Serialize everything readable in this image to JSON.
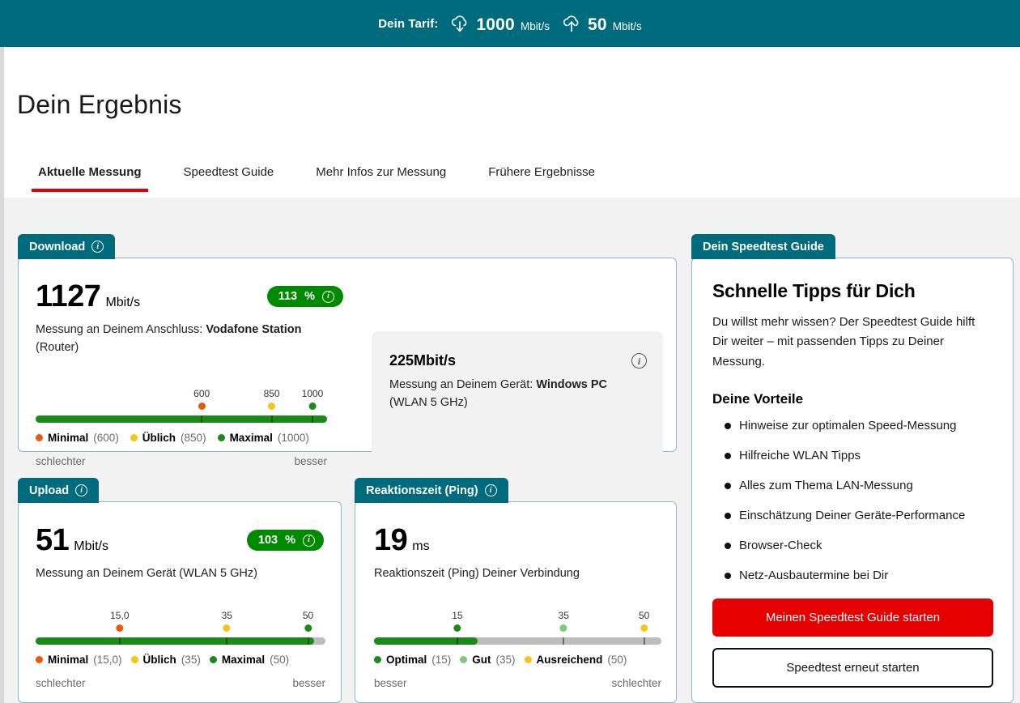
{
  "tariff": {
    "label": "Dein Tarif:",
    "download": {
      "icon": "cloud-download-icon",
      "value": "1000",
      "unit": "Mbit/s"
    },
    "upload": {
      "icon": "cloud-upload-icon",
      "value": "50",
      "unit": "Mbit/s"
    }
  },
  "page": {
    "title": "Dein Ergebnis"
  },
  "tabs": [
    {
      "label": "Aktuelle Messung",
      "active": true
    },
    {
      "label": "Speedtest Guide",
      "active": false
    },
    {
      "label": "Mehr Infos zur Messung",
      "active": false
    },
    {
      "label": "Frühere Ergebnisse",
      "active": false
    }
  ],
  "download_card": {
    "tab_label": "Download",
    "tab_info_icon": "info-icon",
    "value": "1127",
    "unit": "Mbit/s",
    "badge": {
      "value": "113",
      "symbol": "%",
      "info_icon": "info-icon",
      "color": "#008A00"
    },
    "desc_prefix": "Messung an Deinem Anschluss: ",
    "desc_strong": "Vodafone Station",
    "desc_suffix": "(Router)",
    "device_box": {
      "value": "225",
      "unit": "Mbit/s",
      "info_icon": "info-icon",
      "desc_prefix": "Messung an Deinem Gerät: ",
      "desc_strong": "Windows PC",
      "desc_suffix": "(WLAN 5 GHz)"
    },
    "scale": {
      "fill_percent": 100,
      "marks": [
        {
          "label": "600",
          "position": 57,
          "color": "#e8590c"
        },
        {
          "label": "850",
          "position": 81,
          "color": "#f5c518"
        },
        {
          "label": "1000",
          "position": 95,
          "color": "#1a8b18"
        }
      ],
      "legend": [
        {
          "name": "Minimal",
          "value": "(600)",
          "color": "#e8590c"
        },
        {
          "name": "Üblich",
          "value": "(850)",
          "color": "#f5c518"
        },
        {
          "name": "Maximal",
          "value": "(1000)",
          "color": "#1a8b18"
        }
      ],
      "left_end": "schlechter",
      "right_end": "besser"
    }
  },
  "upload_card": {
    "tab_label": "Upload",
    "tab_info_icon": "info-icon",
    "value": "51",
    "unit": "Mbit/s",
    "badge": {
      "value": "103",
      "symbol": "%",
      "info_icon": "info-icon",
      "color": "#008A00"
    },
    "desc": "Messung an Deinem Gerät (WLAN 5 GHz)",
    "scale": {
      "fill_percent": 96,
      "marks": [
        {
          "label": "15,0",
          "position": 29,
          "color": "#e8590c"
        },
        {
          "label": "35",
          "position": 66,
          "color": "#f5c518"
        },
        {
          "label": "50",
          "position": 94,
          "color": "#1a8b18"
        }
      ],
      "legend": [
        {
          "name": "Minimal",
          "value": "(15,0)",
          "color": "#e8590c"
        },
        {
          "name": "Üblich",
          "value": "(35)",
          "color": "#f5c518"
        },
        {
          "name": "Maximal",
          "value": "(50)",
          "color": "#1a8b18"
        }
      ],
      "left_end": "schlechter",
      "right_end": "besser"
    }
  },
  "ping_card": {
    "tab_label": "Reaktionszeit (Ping)",
    "tab_info_icon": "info-icon",
    "value": "19",
    "unit": "ms",
    "desc": "Reaktionszeit (Ping) Deiner Verbindung",
    "scale": {
      "fill_percent": 36,
      "marks": [
        {
          "label": "15",
          "position": 29,
          "color": "#1a8b18"
        },
        {
          "label": "35",
          "position": 66,
          "color": "#7dc87a"
        },
        {
          "label": "50",
          "position": 94,
          "color": "#f5c518"
        }
      ],
      "legend": [
        {
          "name": "Optimal",
          "value": "(15)",
          "color": "#1a8b18"
        },
        {
          "name": "Gut",
          "value": "(35)",
          "color": "#7dc87a"
        },
        {
          "name": "Ausreichend",
          "value": "(50)",
          "color": "#f5c518"
        }
      ],
      "left_end": "besser",
      "right_end": "schlechter"
    }
  },
  "guide_card": {
    "tab_label": "Dein Speedtest Guide",
    "title": "Schnelle Tipps für Dich",
    "text": "Du willst mehr wissen? Der Speedtest Guide hilft Dir weiter – mit passenden Tipps zu Deiner Messung.",
    "benefits_title": "Deine Vorteile",
    "benefits": [
      "Hinweise zur optimalen Speed-Messung",
      "Hilfreiche WLAN Tipps",
      "Alles zum Thema LAN-Messung",
      "Einschätzung Deiner Geräte-Performance",
      "Browser-Check",
      "Netz-Ausbautermine bei Dir"
    ],
    "primary_button": "Meinen Speedtest Guide starten",
    "secondary_button": "Speedtest erneut starten"
  },
  "colors": {
    "brand_teal": "#006B7D",
    "accent_red": "#e60000",
    "good_green": "#008A00",
    "bar_green": "#1a8b18",
    "page_bg": "#f2f2f2"
  }
}
